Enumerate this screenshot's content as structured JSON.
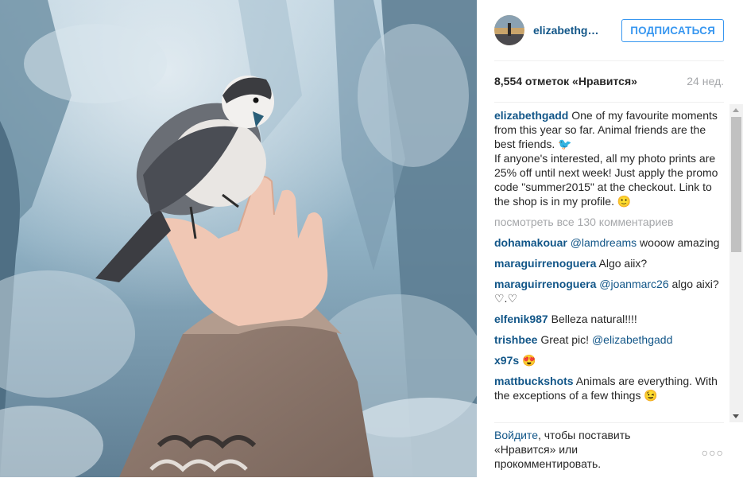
{
  "header": {
    "username": "elizabethgadd",
    "follow_label": "ПОДПИСАТЬСЯ"
  },
  "meta": {
    "likes": "8,554 отметок «Нравится»",
    "age": "24 нед."
  },
  "caption": {
    "user": "elizabethgadd",
    "text": "One of my favourite moments from this year so far. Animal friends are the best friends. 🐦\nIf anyone's interested, all my photo prints are 25% off until next week! Just apply the promo code \"summer2015\" at the checkout. Link to the shop is in my profile. 🙂"
  },
  "view_all": "посмотреть все 130 комментариев",
  "comments": [
    {
      "user": "dohamakouar",
      "mention": "@lamdreams",
      "text": " wooow amazing"
    },
    {
      "user": "maraguirrenoguera",
      "mention": "",
      "text": "Algo aiix?"
    },
    {
      "user": "maraguirrenoguera",
      "mention": "@joanmarc26",
      "text": " algo aixi? ♡.♡"
    },
    {
      "user": "elfenik987",
      "mention": "",
      "text": "Belleza natural!!!!"
    },
    {
      "user": "trishbee",
      "mention": "",
      "text": "Great pic! ",
      "mention_after": "@elizabethgadd"
    },
    {
      "user": "x97s",
      "mention": "",
      "text": "😍"
    },
    {
      "user": "mattbuckshots",
      "mention": "",
      "text": "Animals are everything. With the exceptions of a few things 😉"
    }
  ],
  "footer": {
    "login_link": "Войдите",
    "login_text": ", чтобы поставить «Нравится» или прокомментировать.",
    "more_icon": "ellipsis-icon",
    "more_glyph": "○○○"
  }
}
